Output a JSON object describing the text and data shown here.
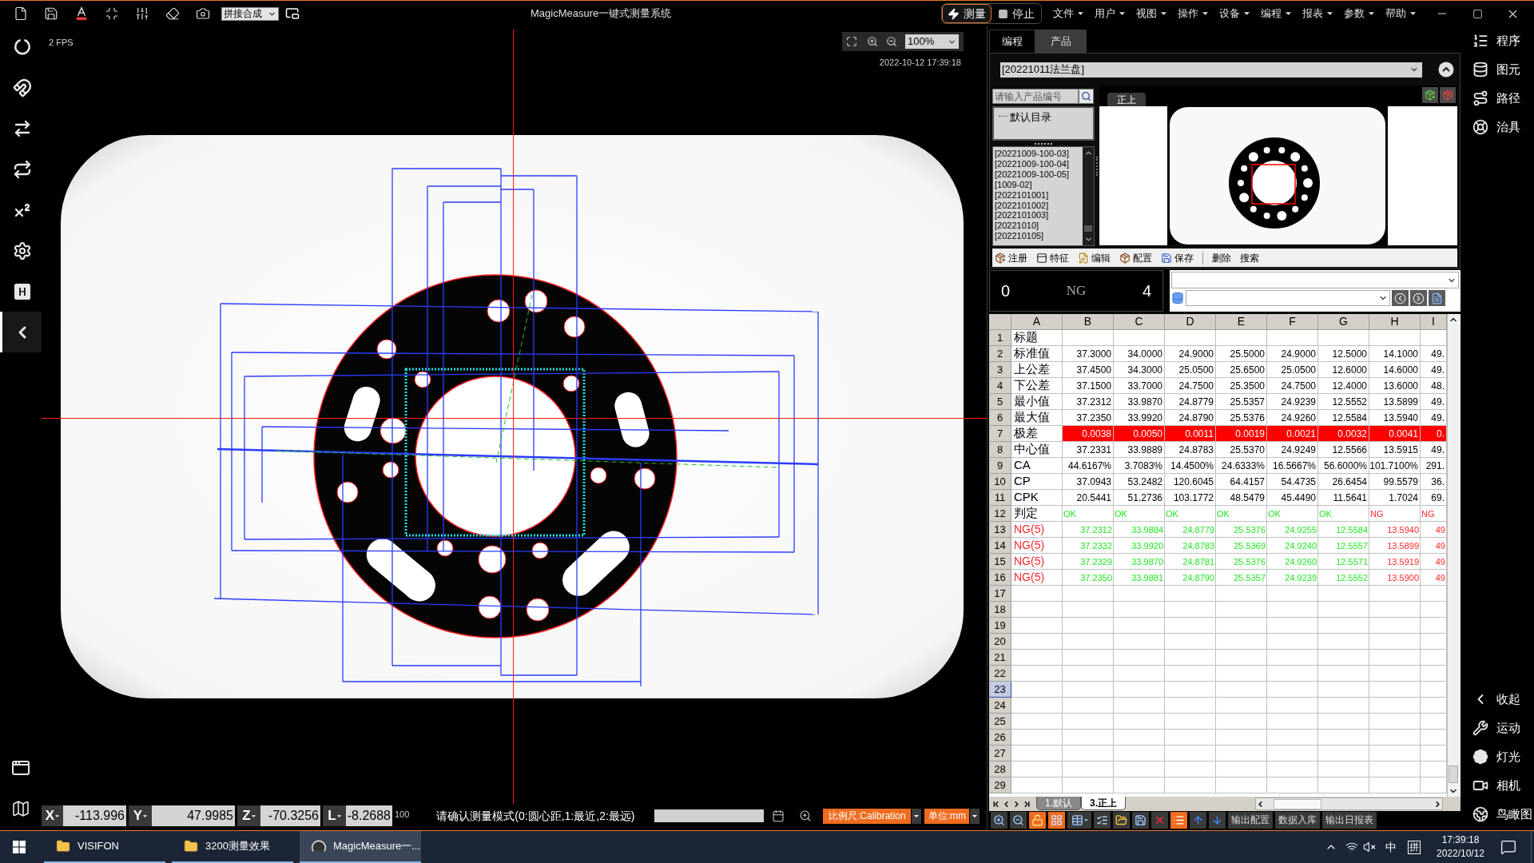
{
  "title_bar": {
    "mode": "拼接合成",
    "title": "MagicMeasure一键式测量系统",
    "actions": [
      {
        "label": "测量",
        "selected": true
      },
      {
        "label": "停止",
        "selected": false
      }
    ],
    "menus": [
      "文件",
      "用户",
      "视图",
      "操作",
      "设备",
      "编程",
      "报表",
      "参数",
      "帮助"
    ]
  },
  "left_toolbar": [
    {
      "selected": false
    },
    {
      "selected": false
    },
    {
      "selected": false
    },
    {
      "selected": false
    },
    {
      "selected": false
    },
    {
      "selected": false
    },
    {
      "selected": false
    },
    {
      "selected": true
    }
  ],
  "camera_view": {
    "fps": "2 FPS",
    "zoom": "100%",
    "timestamp": "2022-10-12 17:39:18"
  },
  "status_bar": {
    "coordinates": [
      {
        "axis": "X",
        "value": "-113.996"
      },
      {
        "axis": "Y",
        "value": "47.9985"
      },
      {
        "axis": "Z",
        "value": "-70.3256"
      },
      {
        "axis": "L",
        "value": "-8.2688"
      }
    ],
    "magnification": "100",
    "message": "请确认测量模式(0:圆心距,1:最近,2:最远)",
    "scale": "比例尺:Calibration",
    "unit": "单位:mm"
  },
  "product_panel": {
    "tabs": [
      {
        "label": "编程",
        "selected": false
      },
      {
        "label": "产品",
        "selected": true
      }
    ],
    "product": "[20221011法兰盘]",
    "search": {
      "placeholder": "请输入产品编号"
    },
    "folder": "默认目录",
    "items": [
      "[20221009-100-03]",
      "[20221009-100-04]",
      "[20221009-100-05]",
      "[1009-02]",
      "[2022101001]",
      "[2022101002]",
      "[2022101003]",
      "[20221010]",
      "[202210105]"
    ],
    "preview_tab": "正上",
    "actions": [
      {
        "label": "注册",
        "kind": "icon"
      },
      {
        "label": "特征",
        "kind": "icon"
      },
      {
        "label": "编辑",
        "kind": "icon"
      },
      {
        "label": "配置",
        "kind": "icon"
      },
      {
        "label": "保存",
        "kind": "icon"
      },
      {
        "label": "删除",
        "kind": "text"
      },
      {
        "label": "搜索",
        "kind": "text"
      }
    ]
  },
  "counter": {
    "left_value": "0",
    "label": "NG",
    "right_value": "4"
  },
  "sheet": {
    "columns": [
      "A",
      "B",
      "C",
      "D",
      "E",
      "F",
      "G",
      "H",
      "I"
    ],
    "rows": [
      {
        "number": "1",
        "selected": false,
        "kind": "plain",
        "cells": [
          "标题"
        ]
      },
      {
        "number": "2",
        "selected": false,
        "kind": "plain",
        "cells": [
          "标准值",
          "37.3000",
          "34.0000",
          "24.9000",
          "25.5000",
          "24.9000",
          "12.5000",
          "14.1000",
          "49."
        ]
      },
      {
        "number": "3",
        "selected": false,
        "kind": "plain",
        "cells": [
          "上公差",
          "37.4500",
          "34.3000",
          "25.0500",
          "25.6500",
          "25.0500",
          "12.6000",
          "14.6000",
          "49."
        ]
      },
      {
        "number": "4",
        "selected": false,
        "kind": "plain",
        "cells": [
          "下公差",
          "37.1500",
          "33.7000",
          "24.7500",
          "25.3500",
          "24.7500",
          "12.4000",
          "13.6000",
          "48."
        ]
      },
      {
        "number": "5",
        "selected": false,
        "kind": "plain",
        "cells": [
          "最小值",
          "37.2312",
          "33.9870",
          "24.8779",
          "25.5357",
          "24.9239",
          "12.5552",
          "13.5899",
          "49."
        ]
      },
      {
        "number": "6",
        "selected": false,
        "kind": "plain",
        "cells": [
          "最大值",
          "37.2350",
          "33.9920",
          "24.8790",
          "25.5376",
          "24.9260",
          "12.5584",
          "13.5940",
          "49."
        ]
      },
      {
        "number": "7",
        "selected": false,
        "kind": "alarm",
        "cells": [
          "极差",
          "0.0038",
          "0.0050",
          "0.0011",
          "0.0019",
          "0.0021",
          "0.0032",
          "0.0041",
          "0."
        ]
      },
      {
        "number": "8",
        "selected": false,
        "kind": "plain",
        "cells": [
          "中心值",
          "37.2331",
          "33.9889",
          "24.8783",
          "25.5370",
          "24.9249",
          "12.5566",
          "13.5915",
          "49."
        ]
      },
      {
        "number": "9",
        "selected": false,
        "kind": "plain",
        "cells": [
          "CA",
          "44.6167%",
          "3.7083%",
          "14.4500%",
          "24.6333%",
          "16.5667%",
          "56.6000%",
          "101.7100%",
          "291."
        ]
      },
      {
        "number": "10",
        "selected": false,
        "kind": "plain",
        "cells": [
          "CP",
          "37.0943",
          "53.2482",
          "120.6045",
          "64.4157",
          "54.4735",
          "26.6454",
          "99.5579",
          "36."
        ]
      },
      {
        "number": "11",
        "selected": false,
        "kind": "plain",
        "cells": [
          "CPK",
          "20.5441",
          "51.2736",
          "103.1772",
          "48.5479",
          "45.4490",
          "11.5641",
          "1.7024",
          "69."
        ]
      },
      {
        "number": "12",
        "selected": false,
        "kind": "judgement",
        "cells": [
          {
            "text": "判定",
            "ng": false
          },
          {
            "text": "OK",
            "ng": false
          },
          {
            "text": "OK",
            "ng": false
          },
          {
            "text": "OK",
            "ng": false
          },
          {
            "text": "OK",
            "ng": false
          },
          {
            "text": "OK",
            "ng": false
          },
          {
            "text": "OK",
            "ng": false
          },
          {
            "text": "NG",
            "ng": true
          },
          {
            "text": "NG",
            "ng": true
          }
        ]
      },
      {
        "number": "13",
        "selected": false,
        "kind": "sample",
        "cells": [
          {
            "text": "NG(5)",
            "ng": true
          },
          {
            "text": "37.2312",
            "ng": false
          },
          {
            "text": "33.9884",
            "ng": false
          },
          {
            "text": "24.8779",
            "ng": false
          },
          {
            "text": "25.5376",
            "ng": false
          },
          {
            "text": "24.9255",
            "ng": false
          },
          {
            "text": "12.5584",
            "ng": false
          },
          {
            "text": "13.5940",
            "ng": true
          },
          {
            "text": "49",
            "ng": true
          }
        ]
      },
      {
        "number": "14",
        "selected": false,
        "kind": "sample",
        "cells": [
          {
            "text": "NG(5)",
            "ng": true
          },
          {
            "text": "37.2332",
            "ng": false
          },
          {
            "text": "33.9920",
            "ng": false
          },
          {
            "text": "24.8783",
            "ng": false
          },
          {
            "text": "25.5369",
            "ng": false
          },
          {
            "text": "24.9240",
            "ng": false
          },
          {
            "text": "12.5557",
            "ng": false
          },
          {
            "text": "13.5899",
            "ng": true
          },
          {
            "text": "49",
            "ng": true
          }
        ]
      },
      {
        "number": "15",
        "selected": false,
        "kind": "sample",
        "cells": [
          {
            "text": "NG(5)",
            "ng": true
          },
          {
            "text": "37.2329",
            "ng": false
          },
          {
            "text": "33.9870",
            "ng": false
          },
          {
            "text": "24.8781",
            "ng": false
          },
          {
            "text": "25.5376",
            "ng": false
          },
          {
            "text": "24.9260",
            "ng": false
          },
          {
            "text": "12.5571",
            "ng": false
          },
          {
            "text": "13.5919",
            "ng": true
          },
          {
            "text": "49",
            "ng": true
          }
        ]
      },
      {
        "number": "16",
        "selected": false,
        "kind": "sample",
        "cells": [
          {
            "text": "NG(5)",
            "ng": true
          },
          {
            "text": "37.2350",
            "ng": false
          },
          {
            "text": "33.9881",
            "ng": false
          },
          {
            "text": "24.8790",
            "ng": false
          },
          {
            "text": "25.5357",
            "ng": false
          },
          {
            "text": "24.9239",
            "ng": false
          },
          {
            "text": "12.5552",
            "ng": false
          },
          {
            "text": "13.5900",
            "ng": true
          },
          {
            "text": "49",
            "ng": true
          }
        ]
      },
      {
        "number": "17",
        "selected": false
      },
      {
        "number": "18",
        "selected": false
      },
      {
        "number": "19",
        "selected": false
      },
      {
        "number": "20",
        "selected": false
      },
      {
        "number": "21",
        "selected": false
      },
      {
        "number": "22",
        "selected": false
      },
      {
        "number": "23",
        "selected": true
      },
      {
        "number": "24",
        "selected": false
      },
      {
        "number": "25",
        "selected": false
      },
      {
        "number": "26",
        "selected": false
      },
      {
        "number": "27",
        "selected": false
      },
      {
        "number": "28",
        "selected": false
      },
      {
        "number": "29",
        "selected": false
      }
    ],
    "tabs": [
      {
        "label": "1.默认",
        "selected": false
      },
      {
        "label": "3.正上",
        "selected": true
      }
    ]
  },
  "sheet_toolbar": {
    "tools": [
      {
        "on": false
      },
      {
        "on": false
      },
      {
        "on": true
      },
      {
        "on": true
      },
      {
        "on": false
      },
      {
        "on": false
      },
      {
        "on": false
      },
      {
        "on": false
      },
      {
        "on": false
      },
      {
        "on": true
      },
      {
        "on": false
      },
      {
        "on": false
      }
    ],
    "buttons": [
      "输出配置",
      "数据入库",
      "输出日报表"
    ]
  },
  "side_nav": {
    "top": [
      "程序",
      "图元",
      "路径",
      "治具"
    ],
    "bottom": [
      "收起",
      "运动",
      "灯光",
      "相机",
      "鸟瞰图"
    ]
  },
  "taskbar": {
    "apps": [
      {
        "label": "VISIFON",
        "kind": "folder",
        "selected": false
      },
      {
        "label": "3200测量效果",
        "kind": "folder",
        "selected": false
      },
      {
        "label": "MagicMeasure一...",
        "kind": "app",
        "selected": true
      }
    ],
    "input_mode": "中",
    "ime": "拼",
    "time": "17:39:18",
    "date": "2022/10/12"
  }
}
